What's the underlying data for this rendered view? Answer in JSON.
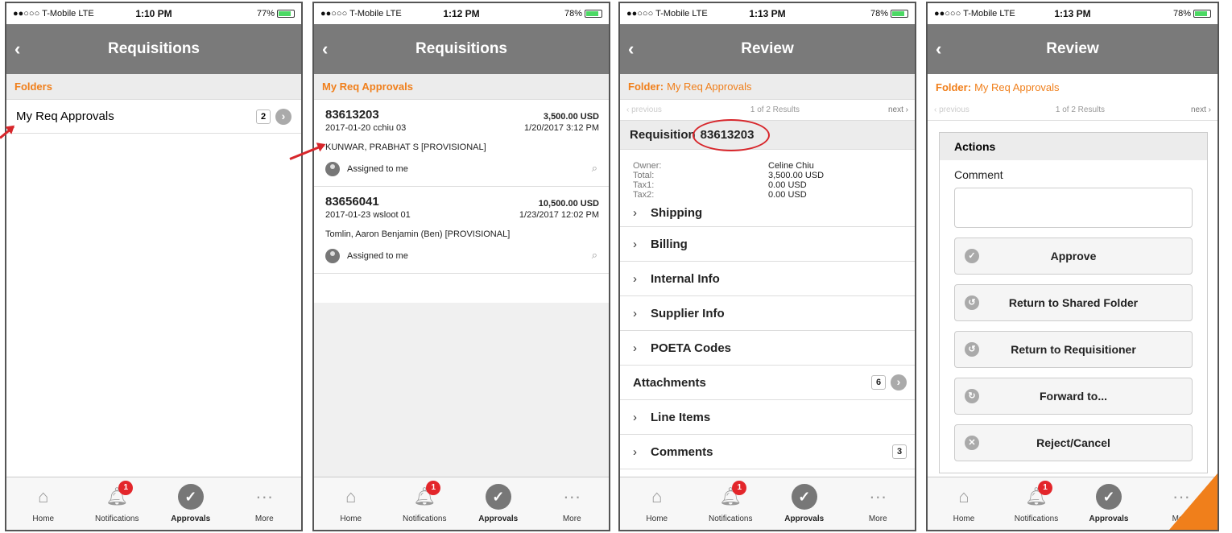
{
  "status": {
    "carrier": "●●○○○ T-Mobile  LTE",
    "screens": [
      {
        "time": "1:10 PM",
        "battery": "77%"
      },
      {
        "time": "1:12 PM",
        "battery": "78%"
      },
      {
        "time": "1:13 PM",
        "battery": "78%"
      },
      {
        "time": "1:13 PM",
        "battery": "78%"
      }
    ]
  },
  "back_icon": "‹",
  "tabbar": {
    "home": "Home",
    "notifications": "Notifications",
    "notifications_badge": "1",
    "approvals": "Approvals",
    "more": "More"
  },
  "screen1": {
    "title": "Requisitions",
    "section": "Folders",
    "folder_label": "My Req Approvals",
    "folder_count": "2"
  },
  "screen2": {
    "title": "Requisitions",
    "section": "My Req Approvals",
    "items": [
      {
        "id": "83613203",
        "amount": "3,500.00 USD",
        "sub": "2017-01-20 cchiu 03",
        "date": "1/20/2017 3:12 PM",
        "name": "KUNWAR, PRABHAT S [PROVISIONAL]",
        "assigned": "Assigned to me"
      },
      {
        "id": "83656041",
        "amount": "10,500.00 USD",
        "sub": "2017-01-23 wsloot 01",
        "date": "1/23/2017 12:02 PM",
        "name": "Tomlin, Aaron Benjamin (Ben) [PROVISIONAL]",
        "assigned": "Assigned to me"
      }
    ]
  },
  "screen3": {
    "title": "Review",
    "folder_prefix": "Folder:",
    "folder_name": "My Req Approvals",
    "pager_prev": "previous",
    "pager_results": "1 of 2 Results",
    "pager_next": "next",
    "req_label": "Requisition",
    "req_number": "83613203",
    "details": [
      {
        "k": "Owner:",
        "v": "Celine Chiu"
      },
      {
        "k": "Total:",
        "v": "3,500.00 USD"
      },
      {
        "k": "Tax1:",
        "v": "0.00 USD"
      },
      {
        "k": "Tax2:",
        "v": "0.00 USD"
      }
    ],
    "sections": {
      "shipping": "Shipping",
      "billing": "Billing",
      "internal": "Internal Info",
      "supplier": "Supplier Info",
      "poeta": "POETA Codes",
      "attachments": "Attachments",
      "attachments_count": "6",
      "line_items": "Line Items",
      "comments": "Comments",
      "comments_count": "3"
    }
  },
  "screen4": {
    "title": "Review",
    "folder_prefix": "Folder:",
    "folder_name": "My Req Approvals",
    "pager_prev": "previous",
    "pager_results": "1 of 2 Results",
    "pager_next": "next",
    "actions_title": "Actions",
    "comment_label": "Comment",
    "buttons": {
      "approve": "Approve",
      "return_shared": "Return to Shared Folder",
      "return_requisitioner": "Return to Requisitioner",
      "forward": "Forward to...",
      "reject": "Reject/Cancel"
    }
  },
  "colors": {
    "accent": "#f07f1b",
    "navbar": "#7a7a7a",
    "annotation": "#d7262b"
  }
}
